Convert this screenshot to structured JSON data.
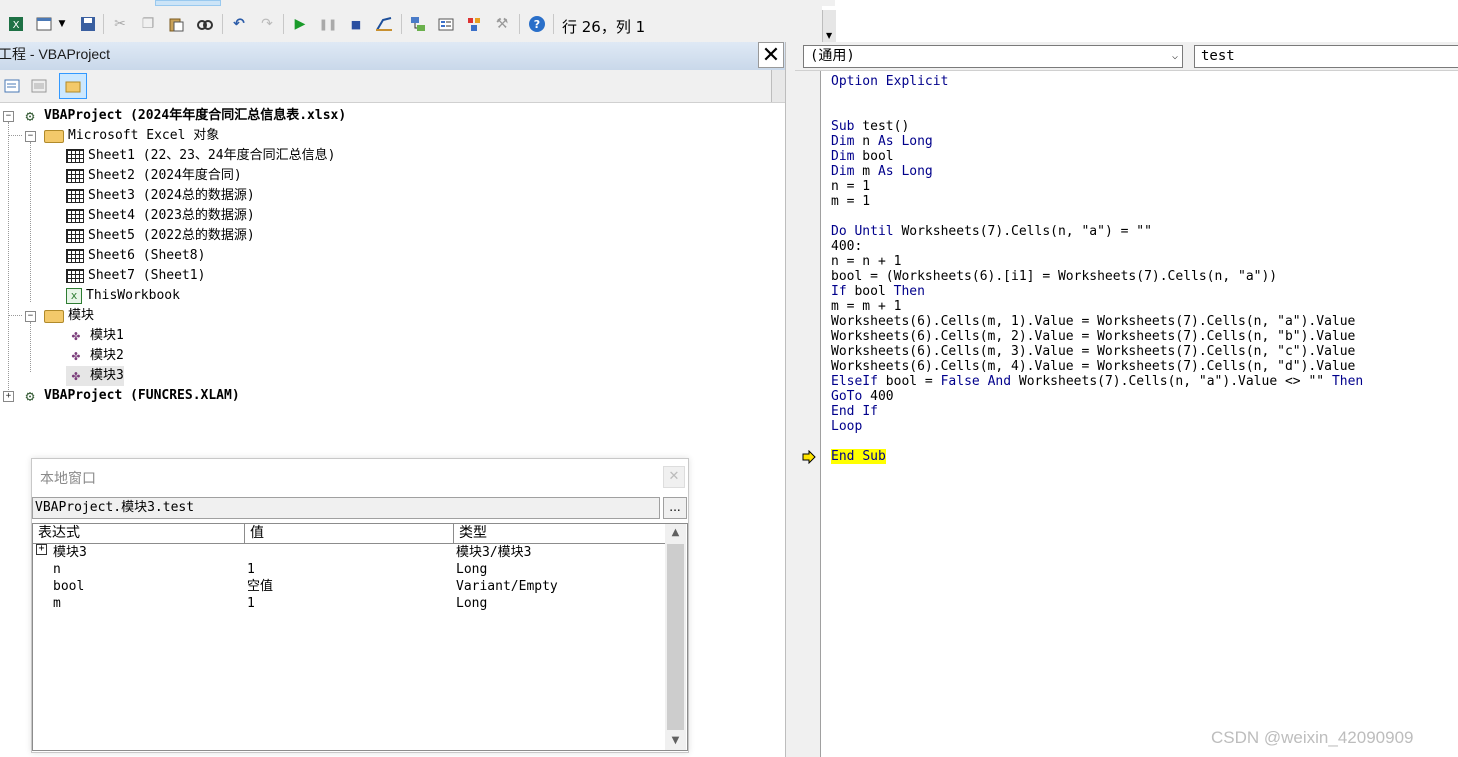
{
  "toolbar": {
    "position": "行 26，列 1",
    "buttons": [
      "excel-icon",
      "insert-userform-icon",
      "dropdown-arrow-icon",
      "save-icon",
      "cut-icon",
      "copy-icon",
      "paste-icon",
      "find-icon",
      "undo-icon",
      "redo-icon",
      "run-icon",
      "break-icon",
      "reset-icon",
      "design-mode-icon",
      "project-explorer-icon",
      "properties-icon",
      "object-browser-icon",
      "toolbox-icon",
      "help-icon"
    ]
  },
  "project": {
    "title": "工程 - VBAProject",
    "close": "✕",
    "tree": [
      {
        "label": "VBAProject (2024年年度合同汇总信息表.xlsx)",
        "bold": true,
        "icon": "vba-project-icon",
        "expander": "−"
      },
      {
        "label": "Microsoft Excel 对象",
        "icon": "folder-icon",
        "expander": "−"
      },
      {
        "label": "Sheet1 (22、23、24年度合同汇总信息)",
        "icon": "sheet-icon"
      },
      {
        "label": "Sheet2 (2024年度合同)",
        "icon": "sheet-icon"
      },
      {
        "label": "Sheet3 (2024总的数据源)",
        "icon": "sheet-icon"
      },
      {
        "label": "Sheet4 (2023总的数据源)",
        "icon": "sheet-icon"
      },
      {
        "label": "Sheet5 (2022总的数据源)",
        "icon": "sheet-icon"
      },
      {
        "label": "Sheet6 (Sheet8)",
        "icon": "sheet-icon"
      },
      {
        "label": "Sheet7 (Sheet1)",
        "icon": "sheet-icon"
      },
      {
        "label": "ThisWorkbook",
        "icon": "workbook-icon"
      },
      {
        "label": "模块",
        "icon": "folder-icon",
        "expander": "−"
      },
      {
        "label": "模块1",
        "icon": "module-icon"
      },
      {
        "label": "模块2",
        "icon": "module-icon"
      },
      {
        "label": "模块3",
        "icon": "module-icon"
      },
      {
        "label": "VBAProject (FUNCRES.XLAM)",
        "bold": true,
        "icon": "vba-project-icon",
        "expander": "+"
      }
    ]
  },
  "locals": {
    "title": "本地窗口",
    "close": "✕",
    "context": "VBAProject.模块3.test",
    "context_button": "...",
    "columns": [
      "表达式",
      "值",
      "类型"
    ],
    "rows": [
      {
        "expr": "模块3",
        "value": "",
        "type": "模块3/模块3",
        "expandable": true
      },
      {
        "expr": "n",
        "value": "1",
        "type": "Long"
      },
      {
        "expr": "bool",
        "value": "空值",
        "type": "Variant/Empty"
      },
      {
        "expr": "m",
        "value": "1",
        "type": "Long"
      }
    ]
  },
  "code": {
    "object_combo": "(通用)",
    "proc_combo": "test",
    "lines": [
      "Option Explicit",
      "",
      "",
      "Sub test()",
      "Dim n As Long",
      "Dim bool",
      "Dim m As Long",
      "n = 1",
      "m = 1",
      "",
      "Do Until Worksheets(7).Cells(n, \"a\") = \"\"",
      "400:",
      "n = n + 1",
      "bool = (Worksheets(6).[i1] = Worksheets(7).Cells(n, \"a\"))",
      "If bool Then",
      "m = m + 1",
      "Worksheets(6).Cells(m, 1).Value = Worksheets(7).Cells(n, \"a\").Value",
      "Worksheets(6).Cells(m, 2).Value = Worksheets(7).Cells(n, \"b\").Value",
      "Worksheets(6).Cells(m, 3).Value = Worksheets(7).Cells(n, \"c\").Value",
      "Worksheets(6).Cells(m, 4).Value = Worksheets(7).Cells(n, \"d\").Value",
      "ElseIf bool = False And Worksheets(7).Cells(n, \"a\").Value <> \"\" Then",
      "GoTo 400",
      "End If",
      "Loop",
      "",
      "End Sub"
    ],
    "current_line_index": 25
  },
  "watermark": "CSDN @weixin_42090909",
  "colors": {
    "keyword": "#00008b",
    "current_line": "#ffff00",
    "arrow": "#ffe500"
  }
}
